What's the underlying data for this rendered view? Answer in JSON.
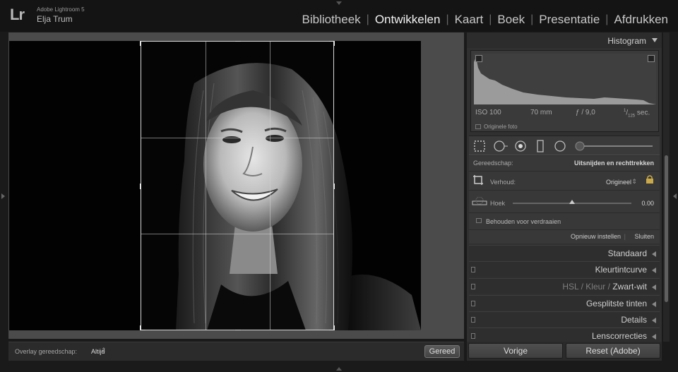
{
  "app": {
    "logo": "Lr",
    "name": "Adobe Lightroom 5",
    "user": "Elja Trum"
  },
  "modules": [
    "Bibliotheek",
    "Ontwikkelen",
    "Kaart",
    "Boek",
    "Presentatie",
    "Afdrukken"
  ],
  "active_module": "Ontwikkelen",
  "toolbar": {
    "overlay_label": "Overlay gereedschap:",
    "overlay_value": "Altijd",
    "done_label": "Gereed"
  },
  "histogram": {
    "title": "Histogram",
    "iso": "ISO 100",
    "focal": "70 mm",
    "aperture": "ƒ / 9,0",
    "shutter_num": "1",
    "shutter_den": "125",
    "shutter_unit": "sec.",
    "original_label": "Originele foto"
  },
  "crop": {
    "tool_label": "Gereedschap:",
    "tool_value": "Uitsnijden en rechttrekken",
    "aspect_label": "Verhoud:",
    "aspect_value": "Origineel",
    "angle_label": "Hoek",
    "angle_value": "0.00",
    "constrain_label": "Behouden voor verdraaien",
    "reset_label": "Opnieuw instellen",
    "close_label": "Sluiten"
  },
  "sections": {
    "standaard": "Standaard",
    "tone_curve": "Kleurtintcurve",
    "hsl": "HSL",
    "kleur": "Kleur",
    "zwartwit": "Zwart-wit",
    "split": "Gesplitste tinten",
    "details": "Details",
    "lens": "Lenscorrecties"
  },
  "buttons": {
    "previous": "Vorige",
    "reset": "Reset (Adobe)"
  }
}
